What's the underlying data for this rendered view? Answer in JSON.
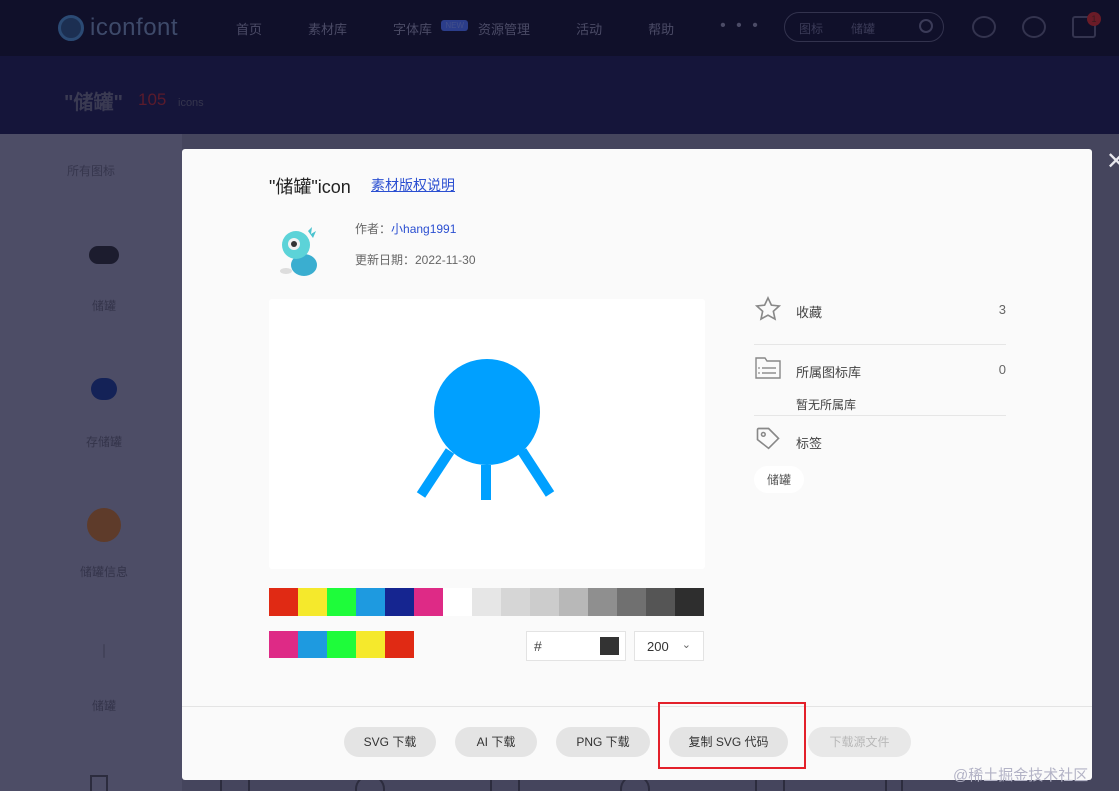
{
  "header": {
    "logo_text": "iconfont",
    "nav": [
      "首页",
      "素材库",
      "字体库",
      "资源管理",
      "活动",
      "帮助"
    ],
    "nav_badge": "NEW",
    "nav_more": "• • •",
    "search": {
      "type": "图标",
      "placeholder": "储罐"
    },
    "cart_count": "1"
  },
  "hero": {
    "title": "\"储罐\"",
    "count": "105",
    "unit": "icons"
  },
  "sidebar": {
    "all_label": "所有图标",
    "items": [
      {
        "label": "储罐",
        "icon": "tank-icon"
      },
      {
        "label": "存储罐",
        "icon": "piggy-bank-icon"
      },
      {
        "label": "储罐信息",
        "icon": "tank-info-icon"
      },
      {
        "label": "储罐",
        "icon": "tank-icon"
      }
    ]
  },
  "modal": {
    "title": "\"储罐\"icon",
    "license_link": "素材版权说明",
    "author_label": "作者：",
    "author_name": "小hang1991",
    "date_text": "更新日期：2022-11-30",
    "preview_color": "#00a0ff",
    "palette_row1": [
      "#e02a14",
      "#f5e92c",
      "#1efc3a",
      "#1e9ae0",
      "#152590",
      "#de2a86",
      "#ffffff",
      "#e6e6e6",
      "#d6d6d6",
      "#cccccc",
      "#b8b8b8",
      "#8f8f8f",
      "#707070",
      "#555555",
      "#2e2e2e"
    ],
    "palette_row2": [
      "#de2a86",
      "#1e9ae0",
      "#1efc3a",
      "#f5e92c",
      "#e02a14"
    ],
    "hex_prefix": "#",
    "hex_color": "#333333",
    "size_value": "200",
    "info": {
      "favorite_label": "收藏",
      "favorite_count": "3",
      "library_label": "所属图标库",
      "library_count": "0",
      "library_empty": "暂无所属库",
      "tags_label": "标签",
      "tags": [
        "储罐"
      ]
    },
    "buttons": {
      "svg_download": "SVG 下载",
      "ai_download": "AI 下载",
      "png_download": "PNG 下载",
      "copy_svg": "复制 SVG 代码",
      "download_source": "下载源文件"
    },
    "highlight_color": "#e3202a"
  },
  "watermark": "@稀土掘金技术社区"
}
